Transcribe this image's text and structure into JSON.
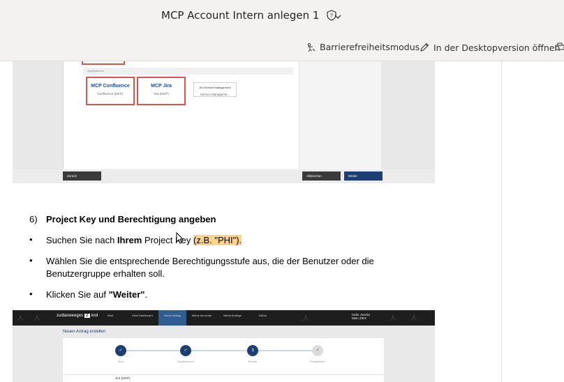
{
  "titlebar": {
    "document_title": "MCP Account Intern anlegen 1"
  },
  "commandbar": {
    "accessibility_label": "Barrierefreiheitsmodus",
    "desktop_label": "In der Desktopversion öffnen"
  },
  "screenshot1": {
    "section_label": "Applikationen",
    "tile_confluence_logo": "MCP Confluence",
    "tile_confluence_caption": "Confluence (MCP)",
    "tile_jira_logo": "MCP Jira",
    "tile_jira_caption": "Jira (MCP)",
    "tile_service_logo": "Jira Service Management",
    "tile_service_caption": "Service Manageme...",
    "btn_back": "Zurück",
    "btn_cancel": "Abbrechen",
    "btn_next": "Weiter"
  },
  "content": {
    "step_number": "6)",
    "step_heading": "Project Key und Berechtigung angeben",
    "bullet1_pre": "Suchen Sie nach ",
    "bullet1_bold": "Ihrem",
    "bullet1_mid": " Project Key ",
    "bullet1_hl": "(z.B. \"PHI\").",
    "bullet2": "Wählen Sie die entsprechende Berechtigungsstufe aus, die der Benutzer oder die Benutzergruppe erhalten soll.",
    "bullet3_pre": "Klicken Sie auf ",
    "bullet3_bold": "\"Weiter\"",
    "bullet3_post": "."
  },
  "screenshot2": {
    "brand_left": "zudiasweeges",
    "brand_right": "tool",
    "nav_items": [
      "Start",
      "Mein Dashboard",
      "Neuer Antrag",
      "Meine Accounts",
      "Meine Anträge",
      "ToDos"
    ],
    "user_line1": "Hallo Joscha",
    "user_line2": "Mein ZIEX",
    "page_subtitle": "Neuen Antrag erstellen",
    "steps": [
      {
        "num": "",
        "label": "Start"
      },
      {
        "num": "",
        "label": "Applikationen"
      },
      {
        "num": "3",
        "label": "Rechte"
      },
      {
        "num": "4",
        "label": "Fertigstellen"
      }
    ],
    "row_label": "Jira (MCP)"
  }
}
